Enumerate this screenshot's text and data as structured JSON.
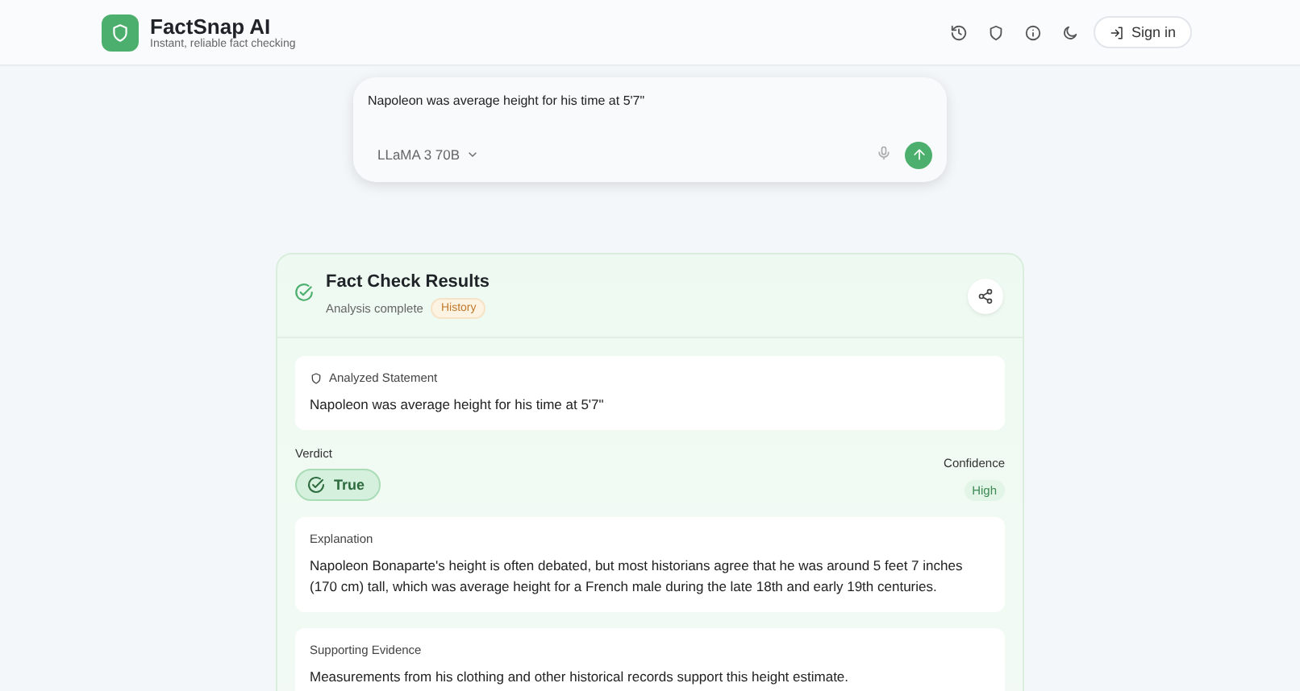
{
  "header": {
    "app_name": "FactSnap AI",
    "tagline": "Instant, reliable fact checking",
    "sign_in": "Sign in"
  },
  "prompt": {
    "value": "Napoleon was average height for his time at 5'7\"",
    "model": "LLaMA 3 70B"
  },
  "results": {
    "title": "Fact Check Results",
    "status": "Analysis complete",
    "tag": "History",
    "statement": {
      "label": "Analyzed Statement",
      "text": "Napoleon was average height for his time at 5'7\""
    },
    "verdict": {
      "label": "Verdict",
      "value": "True",
      "kind": "true"
    },
    "confidence": {
      "label": "Confidence",
      "value": "High"
    },
    "sections": [
      {
        "title": "Explanation",
        "text": "Napoleon Bonaparte's height is often debated, but most historians agree that he was around 5 feet 7 inches (170 cm) tall, which was average height for a French male during the late 18th and early 19th centuries."
      },
      {
        "title": "Supporting Evidence",
        "text": "Measurements from his clothing and other historical records support this height estimate."
      }
    ]
  }
}
